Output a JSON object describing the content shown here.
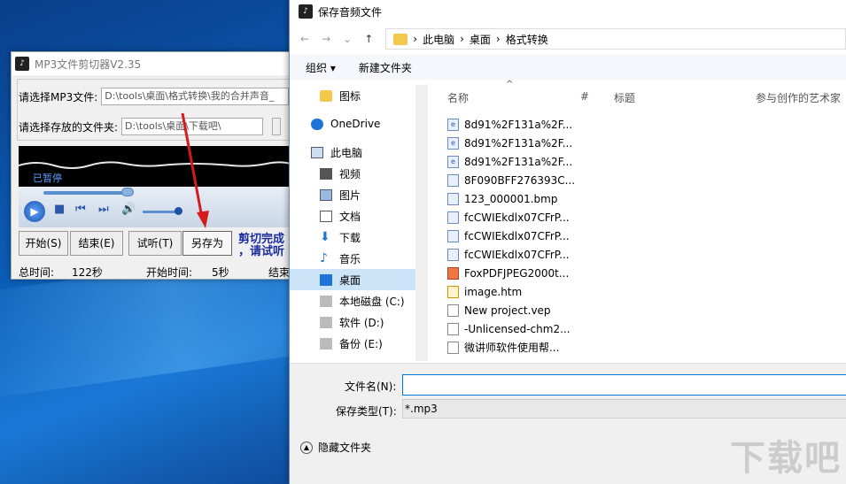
{
  "mp3_window": {
    "title": "MP3文件剪切器V2.35",
    "mp3_label": "请选择MP3文件:",
    "mp3_path": "D:\\tools\\桌面\\格式转换\\我的合并声音_",
    "folder_label": "请选择存放的文件夹:",
    "folder_path": "D:\\tools\\桌面\\下载吧\\",
    "wave_status": "已暂停",
    "buttons": {
      "start": "开始(S)",
      "end": "结束(E)",
      "listen": "试听(T)",
      "save_as": "另存为"
    },
    "notice_line1": "剪切完成",
    "notice_line2": "，请试听",
    "total_time_label": "总时间:",
    "total_time": "122秒",
    "start_time_label": "开始时间:",
    "start_time": "5秒",
    "end_time_label": "结束"
  },
  "dialog": {
    "title": "保存音频文件",
    "breadcrumb": [
      "此电脑",
      "桌面",
      "格式转换"
    ],
    "organize": "组织 ▾",
    "new_folder": "新建文件夹",
    "nav": [
      "图标",
      "OneDrive",
      "此电脑",
      "视频",
      "图片",
      "文档",
      "下载",
      "音乐",
      "桌面",
      "本地磁盘 (C:)",
      "软件 (D:)",
      "备份 (E:)"
    ],
    "columns": {
      "name": "名称",
      "num": "#",
      "title": "标题",
      "artist": "参与创作的艺术家"
    },
    "files": [
      "8d91%2F131a%2F...",
      "8d91%2F131a%2F...",
      "8d91%2F131a%2F...",
      "8F090BFF276393C...",
      "123_000001.bmp",
      "fcCWIEkdlx07CFrP...",
      "fcCWIEkdlx07CFrP...",
      "fcCWIEkdlx07CFrP...",
      "FoxPDFJPEG2000t...",
      "image.htm",
      "New project.vep",
      "-Unlicensed-chm2...",
      "微讲师软件使用帮..."
    ],
    "filename_label": "文件名(N):",
    "filename_value": "",
    "filetype_label": "保存类型(T):",
    "filetype_value": "*.mp3",
    "hide_folders": "隐藏文件夹"
  },
  "watermark": "下载吧"
}
